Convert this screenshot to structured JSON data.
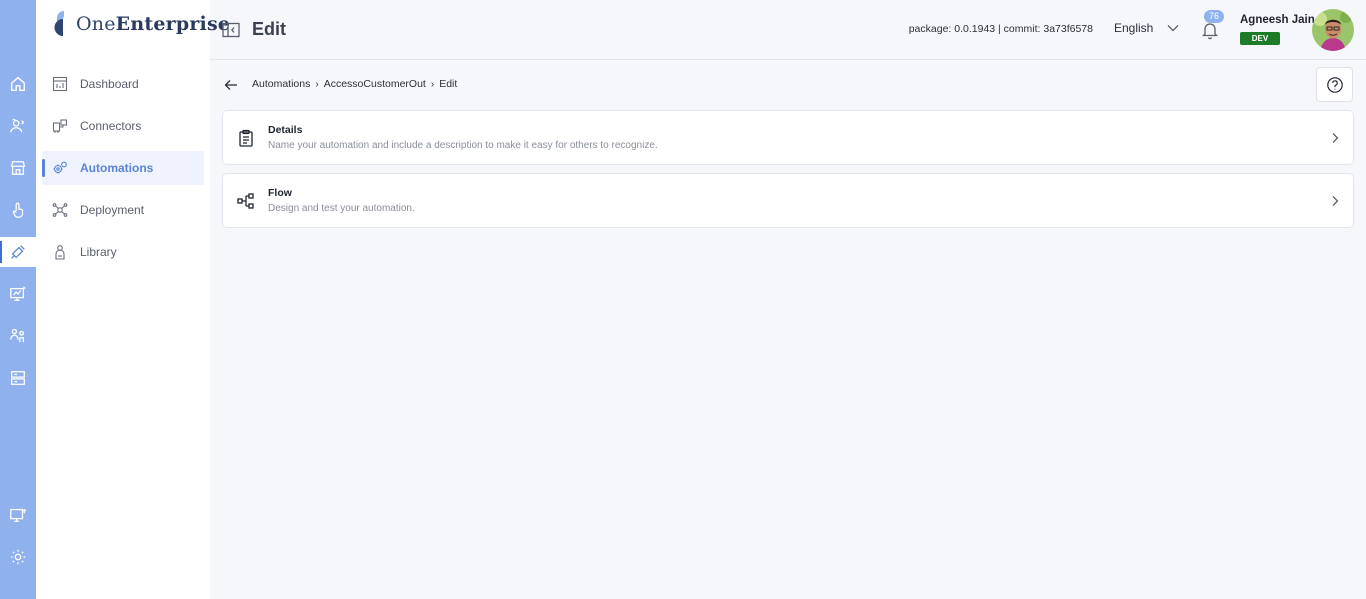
{
  "rail": {
    "items": [
      {
        "icon": "home-icon"
      },
      {
        "icon": "users-icon"
      },
      {
        "icon": "store-icon"
      },
      {
        "icon": "touch-icon"
      },
      {
        "icon": "automation-tools-icon",
        "active": true
      },
      {
        "icon": "monitor-chart-icon"
      },
      {
        "icon": "people-icon"
      },
      {
        "icon": "server-icon"
      }
    ],
    "bottom_items": [
      {
        "icon": "remote-desktop-icon"
      },
      {
        "icon": "settings-icon"
      }
    ]
  },
  "brand": {
    "name_light": "One",
    "name_bold": "Enterprise"
  },
  "sidebar": {
    "items": [
      {
        "label": "Dashboard",
        "icon": "dashboard-icon"
      },
      {
        "label": "Connectors",
        "icon": "connector-icon"
      },
      {
        "label": "Automations",
        "icon": "gears-icon",
        "active": true
      },
      {
        "label": "Deployment",
        "icon": "deploy-icon"
      },
      {
        "label": "Library",
        "icon": "library-icon"
      }
    ]
  },
  "header": {
    "title": "Edit",
    "package_info": "package: 0.0.1943 | commit: 3a73f6578",
    "language": "English",
    "notification_count": "76",
    "user_name": "Agneesh Jain",
    "env_badge": "DEV"
  },
  "breadcrumb": {
    "items": [
      "Automations",
      "AccessoCustomerOut",
      "Edit"
    ]
  },
  "cards": [
    {
      "title": "Details",
      "description": "Name your automation and include a description to make it easy for others to recognize.",
      "icon": "clipboard-icon"
    },
    {
      "title": "Flow",
      "description": "Design and test your automation.",
      "icon": "flow-icon"
    }
  ],
  "colors": {
    "rail_bg": "#8fb2ef",
    "accent": "#5b83d6",
    "dev_badge": "#1e7b27"
  }
}
